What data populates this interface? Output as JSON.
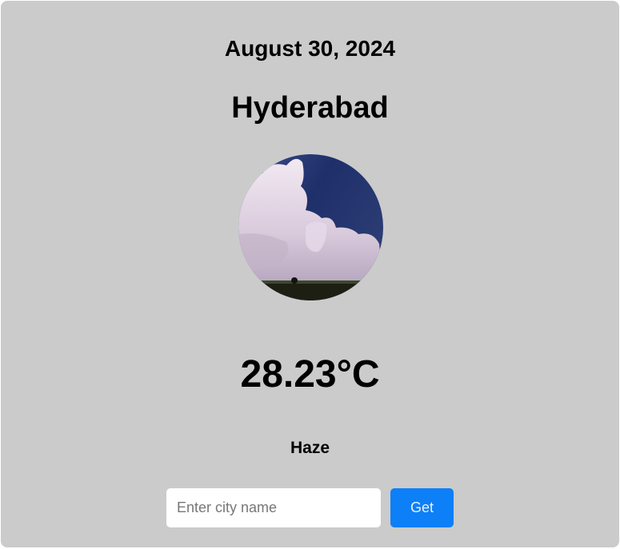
{
  "weather": {
    "date": "August 30, 2024",
    "city": "Hyderabad",
    "temperature": "28.23°C",
    "condition": "Haze",
    "image_icon": "cloudy-sky-photo"
  },
  "search": {
    "placeholder": "Enter city name",
    "value": "",
    "button_label": "Get"
  },
  "colors": {
    "card_background": "#cbcbcb",
    "button_accent": "#0d7ff7"
  }
}
